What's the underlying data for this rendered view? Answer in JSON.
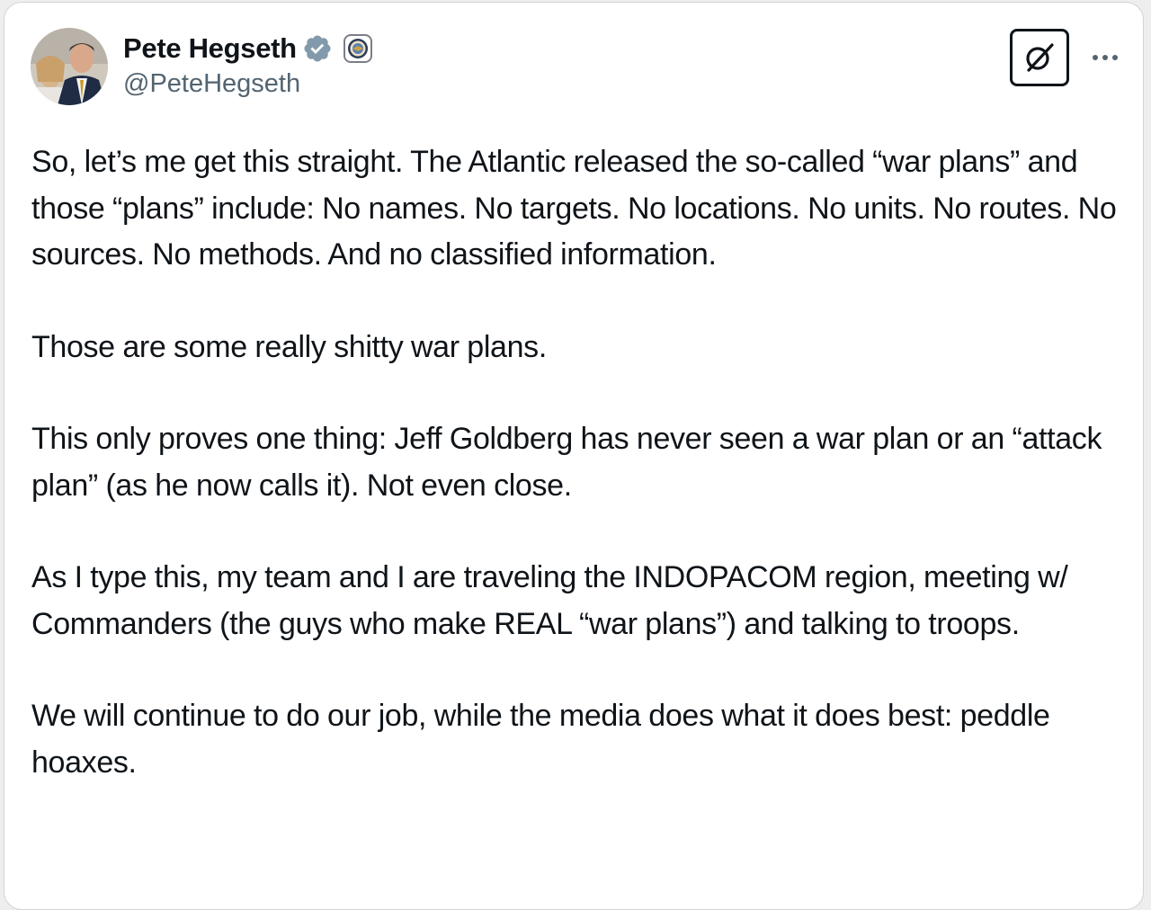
{
  "author": {
    "display_name": "Pete Hegseth",
    "handle": "@PeteHegseth",
    "verified_icon": "verified-badge-icon",
    "affiliation_icon": "government-seal-icon",
    "brand_color": "#829aab"
  },
  "actions": {
    "grok_icon": "grok-icon",
    "more_icon": "more-options-icon"
  },
  "tweet": {
    "paragraphs": [
      "So, let’s me get this straight. The Atlantic released the so-called “war plans” and those “plans” include: No names. No targets. No locations. No units. No routes. No sources. No methods. And no classified information.",
      "Those are some really shitty war plans.",
      "This only proves one thing: Jeff Goldberg has never seen a war plan or an “attack plan” (as he now calls it). Not even close.",
      "As I type this, my team and I are traveling the INDOPACOM region, meeting w/ Commanders (the guys who make REAL “war plans”) and talking to troops.",
      "We will continue to do our job, while the media does what it does best: peddle hoaxes."
    ]
  }
}
